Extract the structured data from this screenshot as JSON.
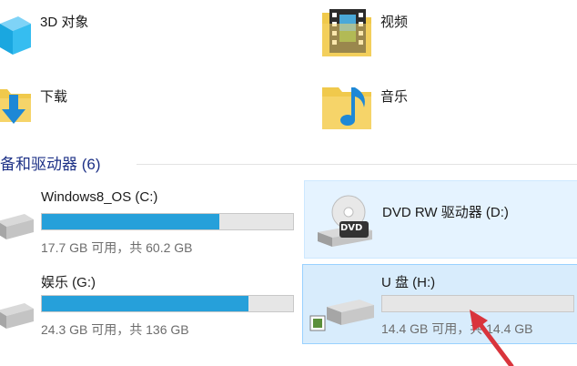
{
  "folders": [
    {
      "label": "3D 对象",
      "icon": "3d-objects-icon"
    },
    {
      "label": "视频",
      "icon": "videos-folder-icon"
    },
    {
      "label": "下载",
      "icon": "downloads-folder-icon"
    },
    {
      "label": "音乐",
      "icon": "music-folder-icon"
    }
  ],
  "section": {
    "title": "备和驱动器 (6)"
  },
  "drives": [
    {
      "name": "Windows8_OS (C:)",
      "info": "17.7 GB 可用，共 60.2 GB",
      "used_fraction": 0.706,
      "icon": "hard-drive-icon"
    },
    {
      "name": "DVD RW 驱动器 (D:)",
      "info": "",
      "icon": "dvd-drive-icon",
      "badge": "DVD"
    },
    {
      "name": "娱乐 (G:)",
      "info": "24.3 GB 可用，共 136 GB",
      "used_fraction": 0.821,
      "icon": "hard-drive-icon"
    },
    {
      "name": "U 盘 (H:)",
      "info": "14.4 GB 可用，共 14.4 GB",
      "used_fraction": 0.0,
      "icon": "usb-drive-icon"
    }
  ],
  "colors": {
    "accent": "#26a0da",
    "section_title": "#1e3287",
    "annotation_arrow": "#d9343c",
    "selected_bg": "#e5f3ff"
  }
}
